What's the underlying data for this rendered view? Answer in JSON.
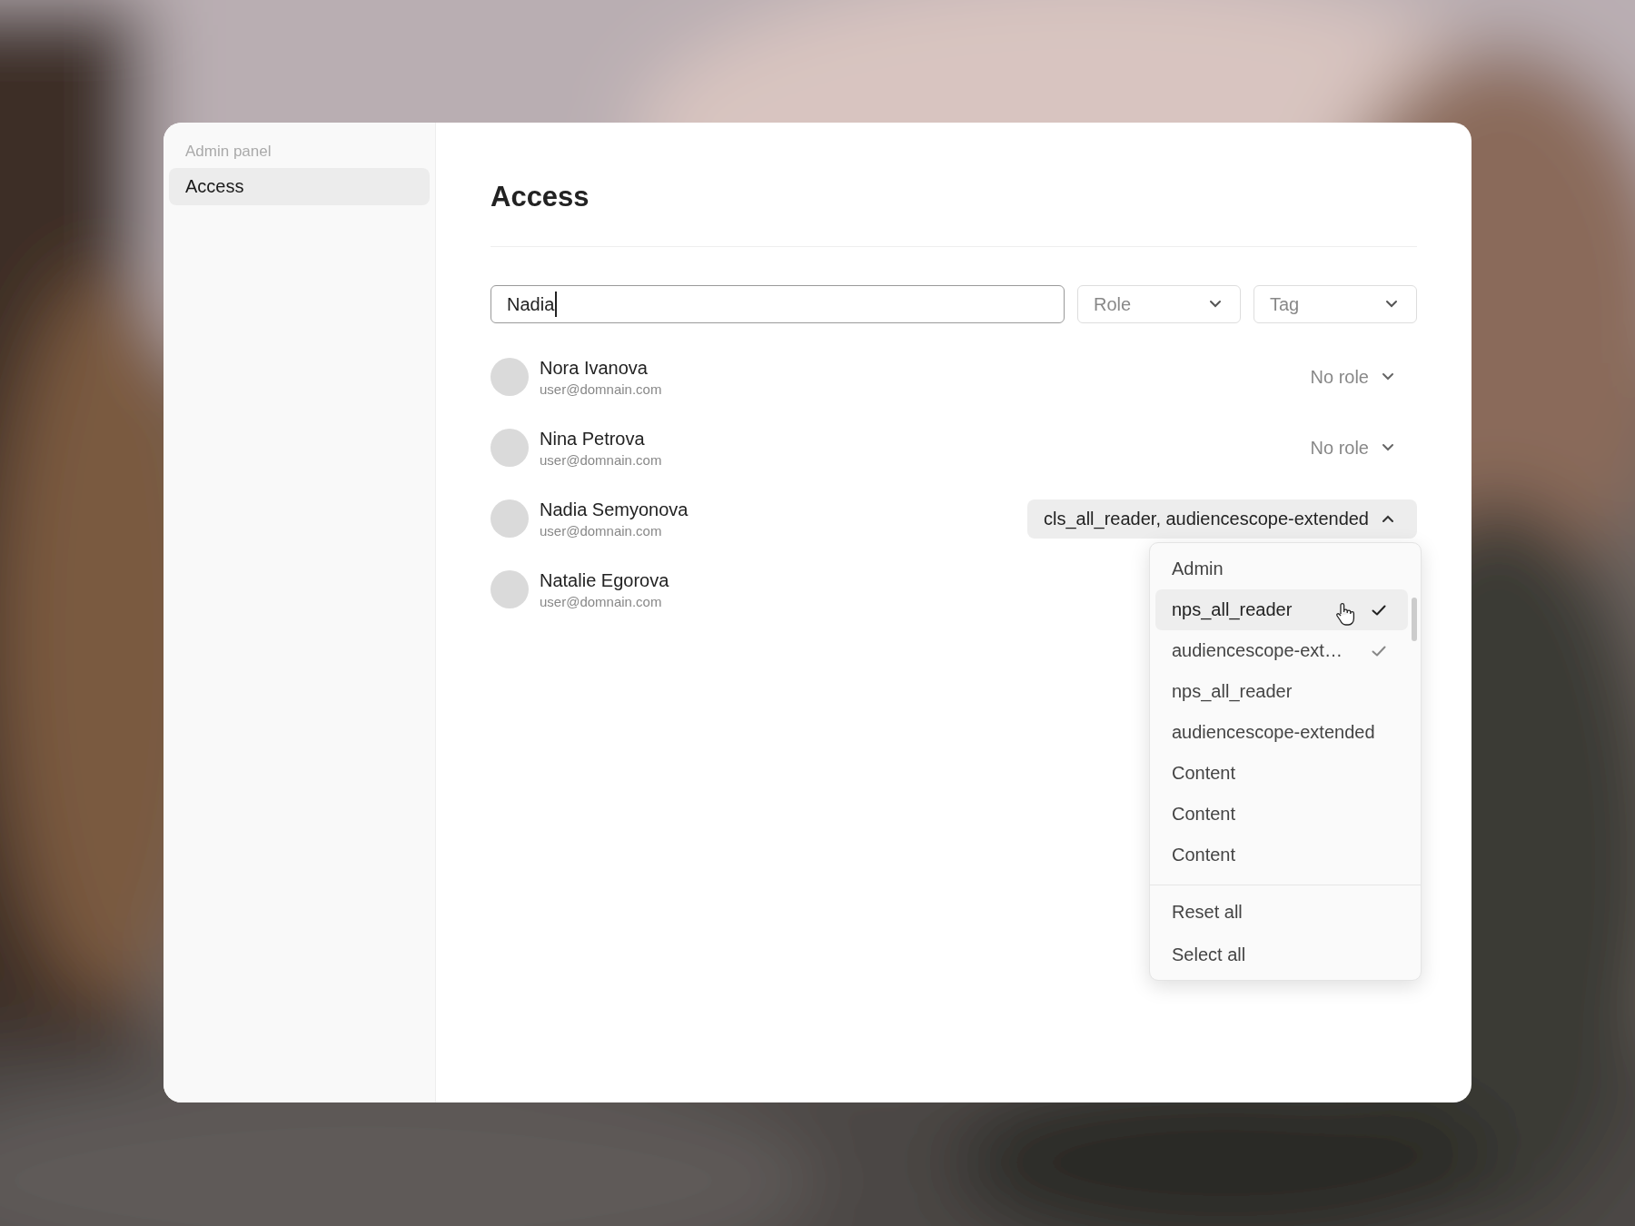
{
  "sidebar": {
    "heading": "Admin panel",
    "items": [
      {
        "label": "Access",
        "selected": true
      }
    ]
  },
  "page": {
    "title": "Access"
  },
  "filters": {
    "search": {
      "value": "Nadia",
      "focused": true
    },
    "dropdowns": [
      {
        "placeholder": "Role"
      },
      {
        "placeholder": "Tag"
      }
    ]
  },
  "users": [
    {
      "name": "Nora Ivanova",
      "email": "user@domnain.com",
      "role": "No role",
      "role_set": false,
      "expanded": false
    },
    {
      "name": "Nina Petrova",
      "email": "user@domnain.com",
      "role": "No role",
      "role_set": false,
      "expanded": false
    },
    {
      "name": "Nadia Semyonova",
      "email": "user@domnain.com",
      "role": "cls_all_reader, audiencescope-extended",
      "role_set": true,
      "expanded": true
    },
    {
      "name": "Natalie Egorova",
      "email": "user@domnain.com"
    }
  ],
  "role_menu": {
    "options": [
      {
        "label": "Admin",
        "checked": false,
        "hovered": false
      },
      {
        "label": "nps_all_reader",
        "checked": true,
        "hovered": true
      },
      {
        "label": "audiencescope-ext…",
        "checked": true,
        "hovered": false
      },
      {
        "label": "nps_all_reader",
        "checked": false,
        "hovered": false
      },
      {
        "label": "audiencescope-extended",
        "checked": false,
        "hovered": false
      },
      {
        "label": "Content",
        "checked": false,
        "hovered": false
      },
      {
        "label": "Content",
        "checked": false,
        "hovered": false
      },
      {
        "label": "Content",
        "checked": false,
        "hovered": false
      }
    ],
    "actions": [
      "Reset all",
      "Select all"
    ]
  }
}
